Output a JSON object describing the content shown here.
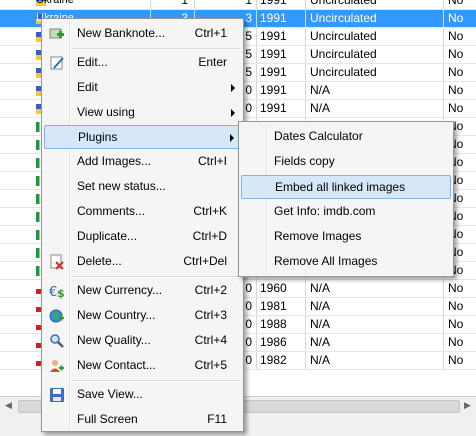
{
  "table": {
    "rows": [
      {
        "name": "Ukraine",
        "qty": "1",
        "nr": "1",
        "year": "1991",
        "grade": "Uncirculated",
        "flag": "No",
        "flag_icon": "ua",
        "selected": false
      },
      {
        "name": "Ukraine",
        "qty": "3",
        "nr": "3",
        "year": "1991",
        "grade": "Uncirculated",
        "flag": "No",
        "flag_icon": "ua",
        "selected": true
      },
      {
        "name": "",
        "qty": "",
        "nr": "5",
        "year": "1991",
        "grade": "Uncirculated",
        "flag": "No",
        "flag_icon": "ua",
        "selected": false
      },
      {
        "name": "",
        "qty": "",
        "nr": "5",
        "year": "1991",
        "grade": "Uncirculated",
        "flag": "No",
        "flag_icon": "ua",
        "selected": false
      },
      {
        "name": "",
        "qty": "",
        "nr": "5",
        "year": "1991",
        "grade": "Uncirculated",
        "flag": "No",
        "flag_icon": "ua",
        "selected": false
      },
      {
        "name": "",
        "qty": "",
        "nr": "0",
        "year": "1991",
        "grade": "N/A",
        "flag": "No",
        "flag_icon": "ua",
        "selected": false
      },
      {
        "name": "",
        "qty": "",
        "nr": "0",
        "year": "1991",
        "grade": "N/A",
        "flag": "No",
        "flag_icon": "ua",
        "selected": false
      },
      {
        "name": "",
        "qty": "",
        "nr": "",
        "year": "",
        "grade": "",
        "flag": "No",
        "flag_icon": "it",
        "selected": false
      },
      {
        "name": "",
        "qty": "",
        "nr": "",
        "year": "",
        "grade": "",
        "flag": "No",
        "flag_icon": "it",
        "selected": false
      },
      {
        "name": "",
        "qty": "",
        "nr": "",
        "year": "",
        "grade": "",
        "flag": "No",
        "flag_icon": "it",
        "selected": false
      },
      {
        "name": "",
        "qty": "",
        "nr": "",
        "year": "",
        "grade": "",
        "flag": "No",
        "flag_icon": "it",
        "selected": false
      },
      {
        "name": "",
        "qty": "",
        "nr": "",
        "year": "",
        "grade": "",
        "flag": "No",
        "flag_icon": "it",
        "selected": false
      },
      {
        "name": "",
        "qty": "",
        "nr": "",
        "year": "",
        "grade": "",
        "flag": "No",
        "flag_icon": "it",
        "selected": false
      },
      {
        "name": "",
        "qty": "",
        "nr": "",
        "year": "",
        "grade": "",
        "flag": "No",
        "flag_icon": "it",
        "selected": false
      },
      {
        "name": "",
        "qty": "",
        "nr": "",
        "year": "",
        "grade": "",
        "flag": "No",
        "flag_icon": "it",
        "selected": false
      },
      {
        "name": "",
        "qty": "",
        "nr": "0",
        "year": "1992",
        "grade": "N/A",
        "flag": "No",
        "flag_icon": "it",
        "selected": false
      },
      {
        "name": "",
        "qty": "",
        "nr": "0",
        "year": "1960",
        "grade": "N/A",
        "flag": "No",
        "flag_icon": "cz",
        "selected": false
      },
      {
        "name": "",
        "qty": "",
        "nr": "0",
        "year": "1981",
        "grade": "N/A",
        "flag": "No",
        "flag_icon": "cz",
        "selected": false
      },
      {
        "name": "",
        "qty": "",
        "nr": "0",
        "year": "1988",
        "grade": "N/A",
        "flag": "No",
        "flag_icon": "pl",
        "selected": false
      },
      {
        "name": "",
        "qty": "",
        "nr": "0",
        "year": "1986",
        "grade": "N/A",
        "flag": "No",
        "flag_icon": "pl",
        "selected": false
      },
      {
        "name": "",
        "qty": "",
        "nr": "0",
        "year": "1982",
        "grade": "N/A",
        "flag": "No",
        "flag_icon": "pl",
        "selected": false
      }
    ]
  },
  "main_menu": {
    "items": [
      {
        "id": "new-banknote",
        "label": "New Banknote...",
        "shortcut": "Ctrl+1",
        "icon": "add-icon"
      },
      {
        "id": "edit-dialog",
        "label": "Edit...",
        "shortcut": "Enter",
        "icon": "edit-icon"
      },
      {
        "id": "edit",
        "label": "Edit",
        "submenu": true
      },
      {
        "id": "view-using",
        "label": "View using",
        "submenu": true
      },
      {
        "id": "plugins",
        "label": "Plugins",
        "submenu": true,
        "highlighted": true
      },
      {
        "id": "add-images",
        "label": "Add Images...",
        "shortcut": "Ctrl+I"
      },
      {
        "id": "set-status",
        "label": "Set new status..."
      },
      {
        "id": "comments",
        "label": "Comments...",
        "shortcut": "Ctrl+K"
      },
      {
        "id": "duplicate",
        "label": "Duplicate...",
        "shortcut": "Ctrl+D"
      },
      {
        "id": "delete",
        "label": "Delete...",
        "shortcut": "Ctrl+Del",
        "icon": "delete-icon"
      },
      {
        "id": "new-currency",
        "label": "New Currency...",
        "shortcut": "Ctrl+2",
        "icon": "currency-icon"
      },
      {
        "id": "new-country",
        "label": "New Country...",
        "shortcut": "Ctrl+3",
        "icon": "globe-icon"
      },
      {
        "id": "new-quality",
        "label": "New Quality...",
        "shortcut": "Ctrl+4",
        "icon": "magnifier-icon"
      },
      {
        "id": "new-contact",
        "label": "New Contact...",
        "shortcut": "Ctrl+5",
        "icon": "contact-icon"
      },
      {
        "id": "save-view",
        "label": "Save View...",
        "icon": "save-icon"
      },
      {
        "id": "full-screen",
        "label": "Full Screen",
        "shortcut": "F11"
      }
    ]
  },
  "sub_menu": {
    "items": [
      {
        "id": "dates-calculator",
        "label": "Dates Calculator"
      },
      {
        "id": "fields-copy",
        "label": "Fields copy"
      },
      {
        "id": "embed-images",
        "label": "Embed all linked images",
        "highlighted": true
      },
      {
        "id": "get-info-imdb",
        "label": "Get Info: imdb.com"
      },
      {
        "id": "remove-images",
        "label": "Remove Images"
      },
      {
        "id": "remove-all-images",
        "label": "Remove All Images"
      }
    ]
  },
  "colors": {
    "selection": "#3399ff",
    "menu_highlight": "#d5e7f8",
    "menu_highlight_border": "#7eb4ea",
    "menu_bg": "#f5f5f5"
  }
}
